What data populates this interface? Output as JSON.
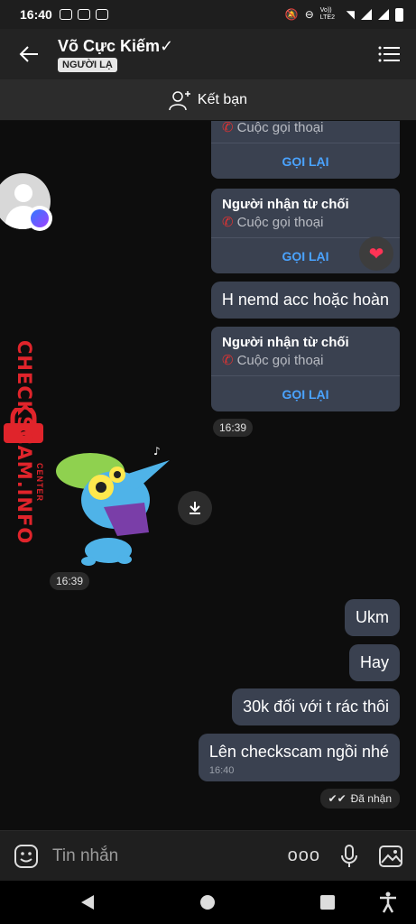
{
  "status_bar": {
    "time": "16:40",
    "network": "Vo)) LTE2"
  },
  "header": {
    "contact_name": "Võ Cực Kiếm✓",
    "badge": "NGƯỜI LẠ"
  },
  "friend_bar": {
    "label": "Kết bạn"
  },
  "messages": {
    "card0": {
      "subtitle": "Cuộc gọi thoại",
      "button": "GỌI LẠI"
    },
    "card1": {
      "title": "Người nhận từ chối",
      "subtitle": "Cuộc gọi thoại",
      "button": "GỌI LẠI"
    },
    "bubble_h": "H nemd acc hoặc hoàn",
    "card2": {
      "title": "Người nhận từ chối",
      "subtitle": "Cuộc gọi thoại",
      "button": "GỌI LẠI"
    },
    "time1": "16:39",
    "time2": "16:39",
    "bubble_ukm": "Ukm",
    "bubble_hay": "Hay",
    "bubble_30k": "30k đối với t rác thôi",
    "bubble_last": "Lên checkscam ngồi nhé",
    "bubble_last_time": "16:40",
    "status": "Đã nhận"
  },
  "watermark": {
    "text": "CHECKSCAM.INFO",
    "sub": "CENTER"
  },
  "input_bar": {
    "placeholder": "Tin nhắn",
    "more": "ooo"
  },
  "colors": {
    "accent": "#4aa3ff",
    "bubble": "#3a4150",
    "heart": "#ff3355",
    "watermark": "#e0242b"
  }
}
